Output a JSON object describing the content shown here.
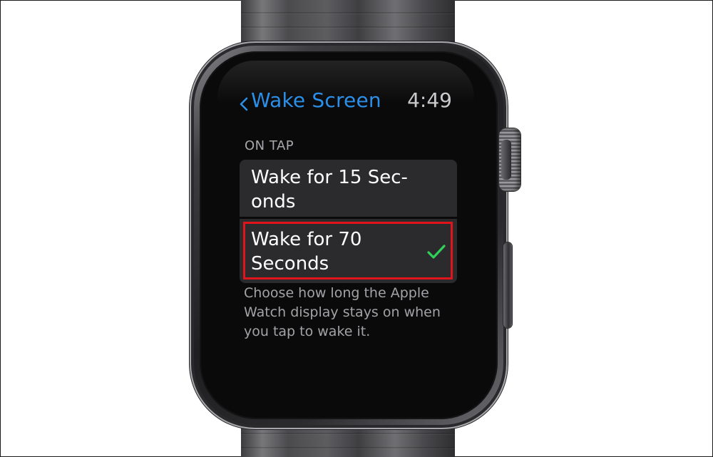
{
  "watch_app": {
    "back_label": "Wake Screen",
    "time": "4:49",
    "section_header": "ON TAP",
    "options": [
      {
        "label": "Wake for 15 Sec-\nonds",
        "selected": false
      },
      {
        "label": "Wake for 70\nSeconds",
        "selected": true
      }
    ],
    "footer": "Choose how long the Apple Watch display stays on when you tap to wake it."
  },
  "colors": {
    "accent": "#2b8fe8",
    "checkmark": "#30d158",
    "highlight": "#e0141a",
    "row_background": "#2b2b2d"
  },
  "icons": [
    "chevron-left-icon",
    "checkmark-icon"
  ]
}
